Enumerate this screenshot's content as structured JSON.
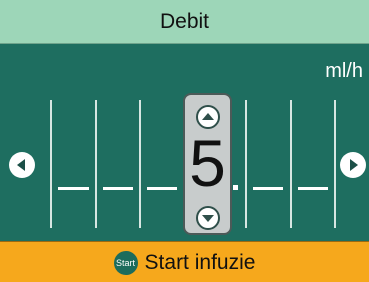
{
  "title": "Debit",
  "unit": "ml/h",
  "value": {
    "selected_digit": "5",
    "decimal_separator": "."
  },
  "icons": {
    "left": "chevron-left-icon",
    "right": "chevron-right-icon",
    "increment": "chevron-up-icon",
    "decrement": "chevron-down-icon",
    "start": "start-icon"
  },
  "start_button": {
    "icon_label": "Start",
    "label": "Start infuzie"
  },
  "colors": {
    "background": "#1e6e60",
    "title_bar": "#9dd6b8",
    "start_bar": "#f6a81c",
    "digit_box": "#c8cccc"
  }
}
